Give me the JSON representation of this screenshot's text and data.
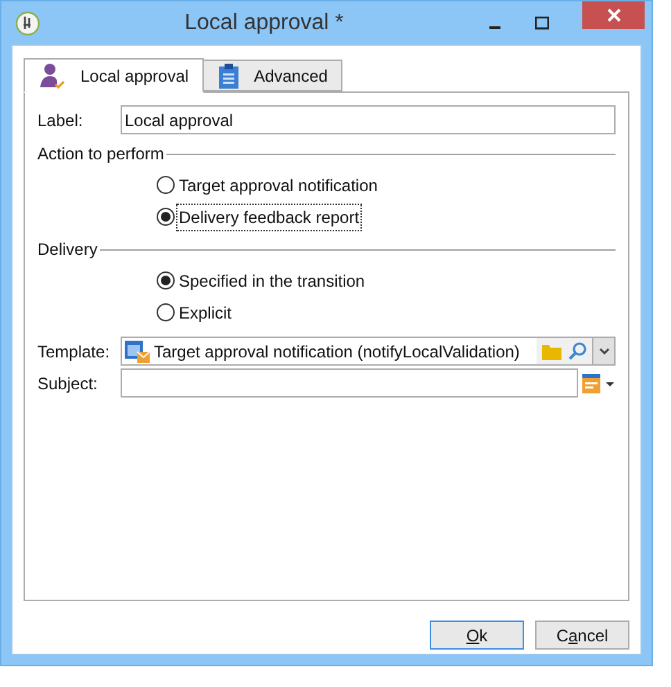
{
  "window": {
    "title": "Local approval *"
  },
  "tabs": [
    {
      "label": "Local approval",
      "selected": true,
      "kind": "person"
    },
    {
      "label": "Advanced",
      "selected": false,
      "kind": "clipboard"
    }
  ],
  "label_field": {
    "label": "Label:",
    "value": "Local approval"
  },
  "action_section": {
    "title": "Action to perform",
    "options": [
      {
        "label": "Target approval notification",
        "selected": false,
        "focused": false
      },
      {
        "label": "Delivery feedback report",
        "selected": true,
        "focused": true
      }
    ]
  },
  "delivery_section": {
    "title": "Delivery",
    "options": [
      {
        "label": "Specified in the transition",
        "selected": true,
        "focused": false
      },
      {
        "label": "Explicit",
        "selected": false,
        "focused": false
      }
    ]
  },
  "template_field": {
    "label": "Template:",
    "value": "Target approval notification (notifyLocalValidation)"
  },
  "subject_field": {
    "label": "Subject:"
  },
  "buttons": [
    {
      "key": "O",
      "after": "k",
      "default": true
    },
    {
      "before": "C",
      "key": "a",
      "after": "ncel",
      "default": false
    }
  ]
}
